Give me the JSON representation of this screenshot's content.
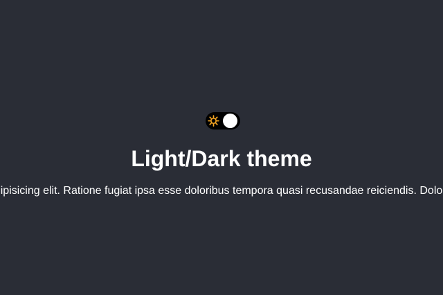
{
  "theme_toggle": {
    "icon": "sun-icon",
    "state": "dark",
    "track_color": "#000000",
    "knob_color": "#ffffff",
    "sun_color": "#f5a623"
  },
  "heading": "Light/Dark theme",
  "paragraph": "Lorem ipsum dolor sit amet consectetur adipisicing elit. Ratione fugiat ipsa esse doloribus tempora quasi recusandae reiciendis. Dolore nam quo quaerat illum eum ullam culpa.",
  "colors": {
    "background": "#2a2d36",
    "text": "#ffffff"
  }
}
